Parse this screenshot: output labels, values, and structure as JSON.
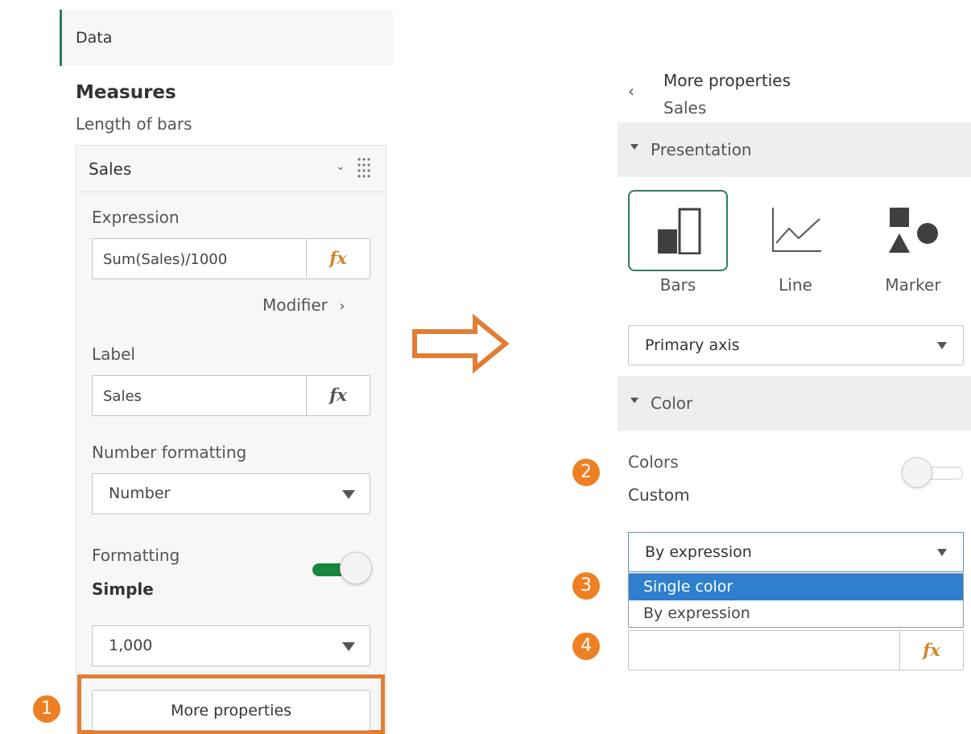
{
  "left_panel": {
    "data_tab": "Data",
    "measures_title": "Measures",
    "measures_subtitle": "Length of bars",
    "measure_name": "Sales",
    "expression_label": "Expression",
    "expression_value": "Sum(Sales)/1000",
    "fx_symbol": "fx",
    "modifier_label": "Modifier",
    "label_label": "Label",
    "label_value": "Sales",
    "number_formatting_label": "Number formatting",
    "number_formatting_value": "Number",
    "formatting_label": "Formatting",
    "formatting_value": "Simple",
    "formatting_toggle_on": true,
    "format_pattern_value": "1,000",
    "more_properties_button": "More properties"
  },
  "right_panel": {
    "title": "More properties",
    "subtitle": "Sales",
    "presentation_section": "Presentation",
    "chart_types": [
      {
        "label": "Bars",
        "selected": true
      },
      {
        "label": "Line",
        "selected": false
      },
      {
        "label": "Marker",
        "selected": false
      }
    ],
    "axis_value": "Primary axis",
    "color_section": "Color",
    "colors_label": "Colors",
    "colors_value": "Custom",
    "colors_toggle_on": false,
    "color_mode_value": "By expression",
    "color_mode_options": [
      "Single color",
      "By expression"
    ],
    "highlighted_option": "Single color",
    "expression_input_value": "",
    "fx_symbol": "fx"
  },
  "annotations": {
    "step1": "1",
    "step2": "2",
    "step3": "3",
    "step4": "4"
  },
  "colors": {
    "accent_orange": "#ee7f22",
    "toggle_green": "#17873f",
    "selected_border": "#2e7d5b",
    "highlight_blue": "#2f7fce",
    "fx_orange": "#d9822b"
  }
}
